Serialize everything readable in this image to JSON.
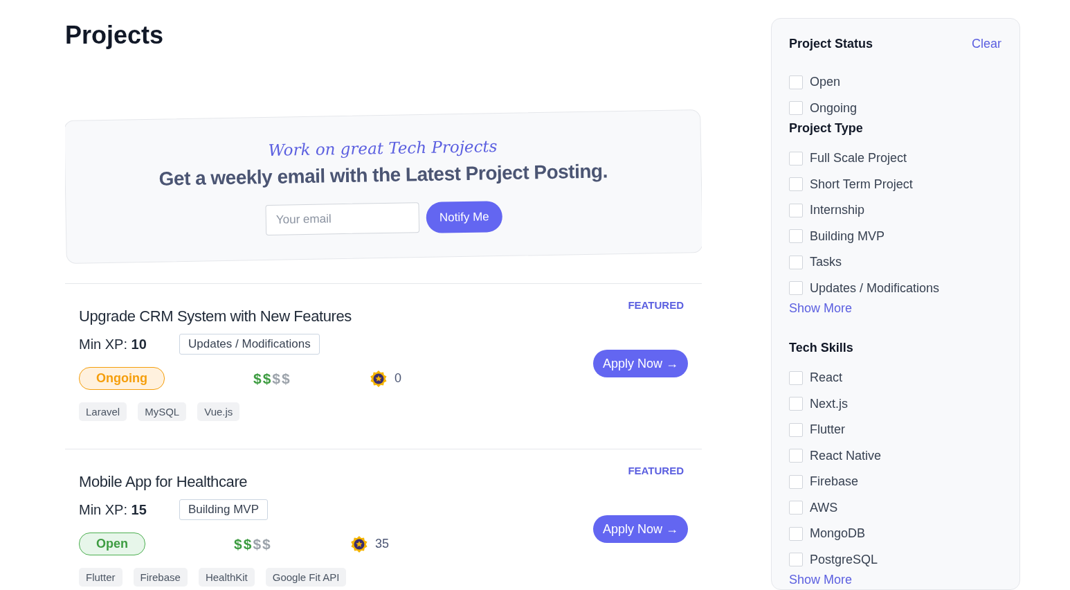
{
  "page_title": "Projects",
  "newsletter": {
    "tagline": "Work on great Tech Projects",
    "headline": "Get a weekly email with the Latest Project Posting.",
    "email_placeholder": "Your email",
    "button": "Notify Me"
  },
  "projects": [
    {
      "title": "Upgrade CRM System with New Features",
      "badge": "FEATURED",
      "xp_label": "Min XP:",
      "xp": "10",
      "type": "Updates / Modifications",
      "status": "Ongoing",
      "kind": "ongoing",
      "price": "$$$$",
      "stars": 2,
      "points": "0",
      "apply": "Apply Now →",
      "tags": [
        "Laravel",
        "MySQL",
        "Vue.js"
      ]
    },
    {
      "title": "Mobile App for Healthcare",
      "badge": "FEATURED",
      "xp_label": "Min XP:",
      "xp": "15",
      "type": "Building MVP",
      "status": "Open",
      "kind": "open",
      "price": "$$$$",
      "stars": 2,
      "points": "35",
      "apply": "Apply Now →",
      "tags": [
        "Flutter",
        "Firebase",
        "HealthKit",
        "Google Fit API"
      ]
    }
  ],
  "filters": {
    "clear": "Clear",
    "groups": [
      {
        "title": "Project Status",
        "items": [
          {
            "label": "Open",
            "checked": false
          },
          {
            "label": "Ongoing",
            "checked": false
          }
        ]
      },
      {
        "title": "Project Type",
        "items": [
          {
            "label": "Full Scale Project",
            "checked": false
          },
          {
            "label": "Short Term Project",
            "checked": false
          },
          {
            "label": "Internship",
            "checked": false
          },
          {
            "label": "Building MVP",
            "checked": false
          },
          {
            "label": "Tasks",
            "checked": false
          },
          {
            "label": "Updates / Modifications",
            "checked": false
          }
        ],
        "show_more": "Show More"
      },
      {
        "title": "Tech Skills",
        "items": [
          {
            "label": "React",
            "checked": false
          },
          {
            "label": "Next.js",
            "checked": false
          },
          {
            "label": "Flutter",
            "checked": false
          },
          {
            "label": "React Native",
            "checked": false
          },
          {
            "label": "Firebase",
            "checked": false
          },
          {
            "label": "AWS",
            "checked": false
          },
          {
            "label": "MongoDB",
            "checked": false
          },
          {
            "label": "PostgreSQL",
            "checked": false
          }
        ],
        "show_more": "Show More"
      }
    ]
  }
}
